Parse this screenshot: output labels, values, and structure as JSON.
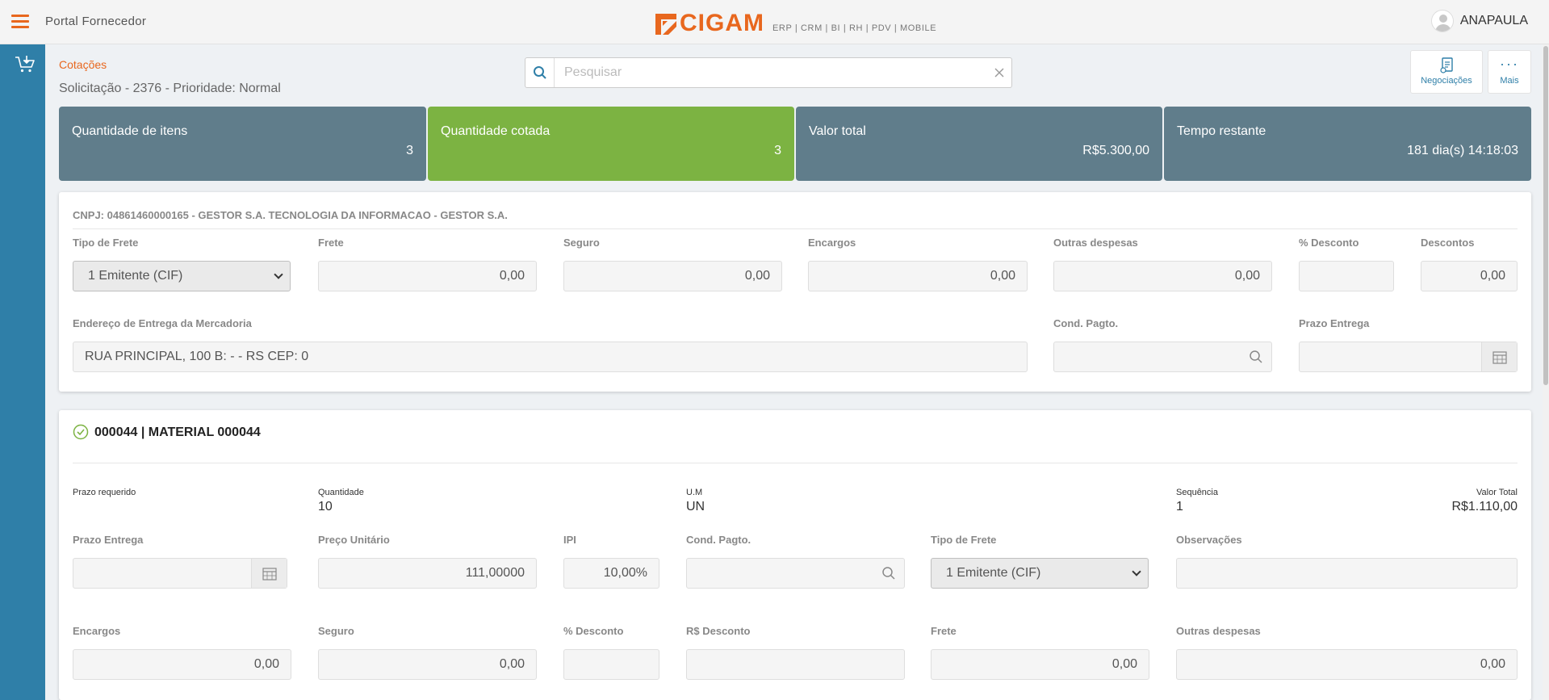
{
  "header": {
    "portal_title": "Portal Fornecedor",
    "logo_text": "CIGAM",
    "logo_sub": "ERP | CRM | BI | RH | PDV | MOBILE",
    "user_name": "ANAPAULA"
  },
  "page": {
    "breadcrumb": "Cotações",
    "title": "Solicitação - 2376 - Prioridade: Normal"
  },
  "search": {
    "placeholder": "Pesquisar",
    "value": ""
  },
  "toolbar": {
    "negociacoes_label": "Negociações",
    "mais_label": "Mais"
  },
  "summary": [
    {
      "title": "Quantidade de itens",
      "value": "3",
      "color": "#607d8b"
    },
    {
      "title": "Quantidade cotada",
      "value": "3",
      "color": "#7cb342"
    },
    {
      "title": "Valor total",
      "value": "R$5.300,00",
      "color": "#607d8b"
    },
    {
      "title": "Tempo restante",
      "value": "181 dia(s) 14:18:03",
      "color": "#607d8b"
    }
  ],
  "supplier": {
    "cnpj_line": "CNPJ: 04861460000165 - GESTOR S.A. TECNOLOGIA DA INFORMACAO - GESTOR S.A.",
    "labels": {
      "tipo_frete": "Tipo de Frete",
      "frete": "Frete",
      "seguro": "Seguro",
      "encargos": "Encargos",
      "outras_despesas": "Outras despesas",
      "pct_desconto": "% Desconto",
      "descontos": "Descontos",
      "endereco": "Endereço de Entrega da Mercadoria",
      "cond_pagto": "Cond. Pagto.",
      "prazo_entrega": "Prazo Entrega"
    },
    "values": {
      "tipo_frete": "1 Emitente (CIF)",
      "frete": "0,00",
      "seguro": "0,00",
      "encargos": "0,00",
      "outras_despesas": "0,00",
      "pct_desconto": "",
      "descontos": "0,00",
      "endereco": "RUA PRINCIPAL, 100 B:  -  - RS CEP: 0",
      "cond_pagto": "",
      "prazo_entrega": ""
    }
  },
  "item": {
    "title": "000044 | MATERIAL 000044",
    "info_labels": {
      "prazo_requerido": "Prazo requerido",
      "quantidade": "Quantidade",
      "um": "U.M",
      "sequencia": "Sequência",
      "valor_total": "Valor Total"
    },
    "info_values": {
      "prazo_requerido": "",
      "quantidade": "10",
      "um": "UN",
      "sequencia": "1",
      "valor_total": "R$1.110,00"
    },
    "labels": {
      "prazo_entrega": "Prazo Entrega",
      "preco_unitario": "Preço Unitário",
      "ipi": "IPI",
      "cond_pagto": "Cond. Pagto.",
      "tipo_frete": "Tipo de Frete",
      "observacoes": "Observações",
      "encargos": "Encargos",
      "seguro": "Seguro",
      "pct_desconto": "% Desconto",
      "rs_desconto": "R$ Desconto",
      "frete": "Frete",
      "outras_despesas": "Outras despesas"
    },
    "values": {
      "prazo_entrega": "",
      "preco_unitario": "111,00000",
      "ipi": "10,00%",
      "cond_pagto": "",
      "tipo_frete": "1 Emitente (CIF)",
      "observacoes": "",
      "encargos": "0,00",
      "seguro": "0,00",
      "pct_desconto": "",
      "rs_desconto": "",
      "frete": "0,00",
      "outras_despesas": "0,00"
    }
  },
  "colors": {
    "accent": "#e8671e",
    "sidebar": "#2f7fa8",
    "success": "#7cb342"
  }
}
